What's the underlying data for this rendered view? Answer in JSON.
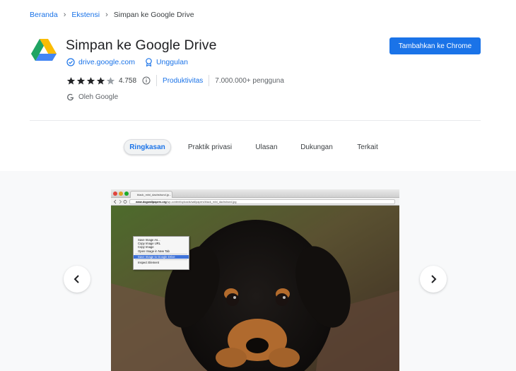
{
  "breadcrumb": {
    "home": "Beranda",
    "extensions": "Ekstensi",
    "current": "Simpan ke Google Drive",
    "separator": "›"
  },
  "extension": {
    "title": "Simpan ke Google Drive",
    "site": "drive.google.com",
    "featured": "Unggulan",
    "rating_stars": 4,
    "rating_max": 5,
    "rating_count": "4.758",
    "category": "Produktivitas",
    "users": "7.000.000+ pengguna",
    "publisher": "Oleh Google"
  },
  "actions": {
    "add_to_chrome": "Tambahkan ke Chrome"
  },
  "tabs": [
    {
      "label": "Ringkasan",
      "active": true
    },
    {
      "label": "Praktik privasi",
      "active": false
    },
    {
      "label": "Ulasan",
      "active": false
    },
    {
      "label": "Dukungan",
      "active": false
    },
    {
      "label": "Terkait",
      "active": false
    }
  ],
  "screenshot": {
    "browser_tab": "black_mini_dachshund.jp...",
    "url_domain": "www.dogwallpapers.org",
    "url_path": "/wp-content/uploads/wallpapers/black_mini_dachshund.jpg",
    "context_menu": [
      {
        "label": "Save Image As...",
        "highlight": false
      },
      {
        "label": "Copy Image URL",
        "highlight": false
      },
      {
        "label": "Copy Image",
        "highlight": false
      },
      {
        "label": "Open Image in New Tab",
        "highlight": false
      },
      {
        "label": "Save Image to Google Drive",
        "highlight": true
      },
      {
        "label": "Inspect Element",
        "highlight": false
      }
    ]
  },
  "colors": {
    "accent": "#1a73e8",
    "text": "#202124",
    "secondary_text": "#5f6368",
    "gallery_bg": "#f8f9fa"
  },
  "icons": {
    "logo": "google-drive-logo",
    "verified": "verified-check-icon",
    "featured": "featured-badge-icon",
    "info": "info-icon",
    "google": "google-g-icon",
    "prev": "chevron-left-icon",
    "next": "chevron-right-icon"
  }
}
